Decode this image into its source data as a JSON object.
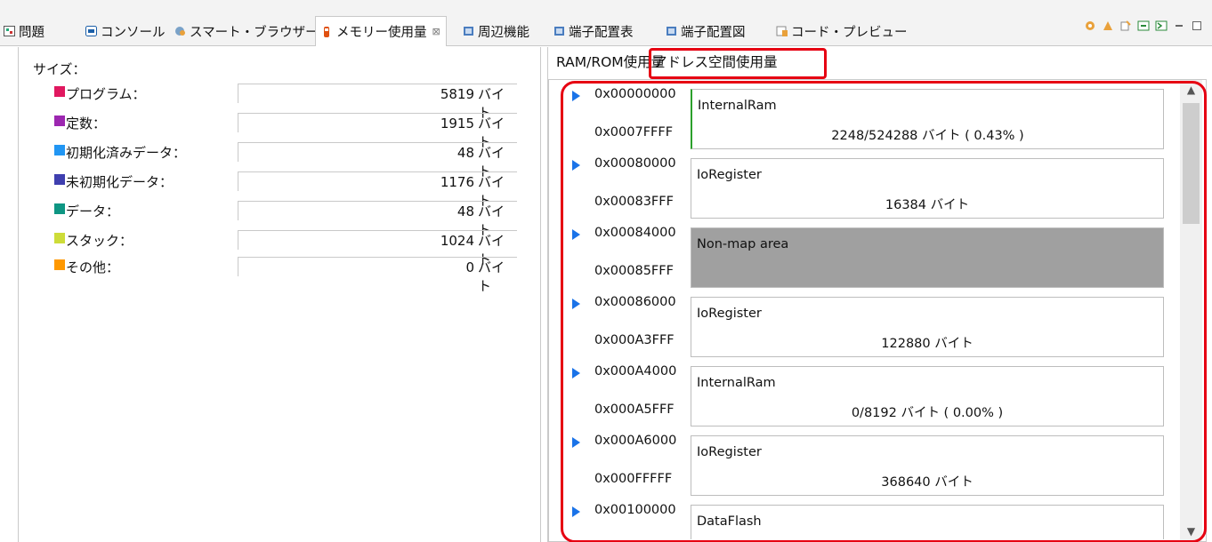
{
  "tabs": [
    {
      "label": "問題",
      "icon": "problems-icon",
      "active": false
    },
    {
      "label": "コンソール",
      "icon": "console-icon",
      "active": false
    },
    {
      "label": "スマート・ブラウザー",
      "icon": "smart-browser-icon",
      "active": false
    },
    {
      "label": "メモリー使用量",
      "icon": "memory-usage-icon",
      "active": true,
      "close": "⊠"
    },
    {
      "label": "周辺機能",
      "icon": "peripheral-icon",
      "active": false
    },
    {
      "label": "端子配置表",
      "icon": "pin-table-icon",
      "active": false
    },
    {
      "label": "端子配置図",
      "icon": "pin-diagram-icon",
      "active": false
    },
    {
      "label": "コード・プレビュー",
      "icon": "code-preview-icon",
      "active": false
    }
  ],
  "size_panel": {
    "heading": "サイズ：",
    "items": [
      {
        "label": "プログラム：",
        "value": "5819",
        "unit": "バイト",
        "color": "#e0185f"
      },
      {
        "label": "定数：",
        "value": "1915",
        "unit": "バイト",
        "color": "#9c27b0"
      },
      {
        "label": "初期化済みデータ：",
        "value": "48",
        "unit": "バイト",
        "color": "#2196f3"
      },
      {
        "label": "未初期化データ：",
        "value": "1176",
        "unit": "バイト",
        "color": "#3f3faf"
      },
      {
        "label": "データ：",
        "value": "48",
        "unit": "バイト",
        "color": "#0e9683"
      },
      {
        "label": "スタック：",
        "value": "1024",
        "unit": "バイト",
        "color": "#cddc39"
      },
      {
        "label": "その他：",
        "value": "0",
        "unit": "バイト",
        "color": "#ff9800"
      }
    ]
  },
  "subtabs": {
    "ram_rom": "RAM/ROM使用量",
    "address_space": "アドレス空間使用量"
  },
  "regions": [
    {
      "start": "0x00000000",
      "end": "0x0007FFFF",
      "name": "InternalRam",
      "usage": "2248/524288 バイト ( 0.43% )",
      "style": "green"
    },
    {
      "start": "0x00080000",
      "end": "0x00083FFF",
      "name": "IoRegister",
      "usage": "16384 バイト",
      "style": "normal"
    },
    {
      "start": "0x00084000",
      "end": "0x00085FFF",
      "name": "Non-map area",
      "usage": "",
      "style": "gray"
    },
    {
      "start": "0x00086000",
      "end": "0x000A3FFF",
      "name": "IoRegister",
      "usage": "122880 バイト",
      "style": "normal"
    },
    {
      "start": "0x000A4000",
      "end": "0x000A5FFF",
      "name": "InternalRam",
      "usage": "0/8192 バイト ( 0.00% )",
      "style": "normal"
    },
    {
      "start": "0x000A6000",
      "end": "0x000FFFFF",
      "name": "IoRegister",
      "usage": "368640 バイト",
      "style": "normal"
    },
    {
      "start": "0x00100000",
      "end": "",
      "name": "DataFlash",
      "usage": "",
      "style": "normal"
    }
  ],
  "colors": {
    "highlight": "#e60012",
    "arrow": "#1a73e8",
    "non_map": "#a0a0a0"
  }
}
